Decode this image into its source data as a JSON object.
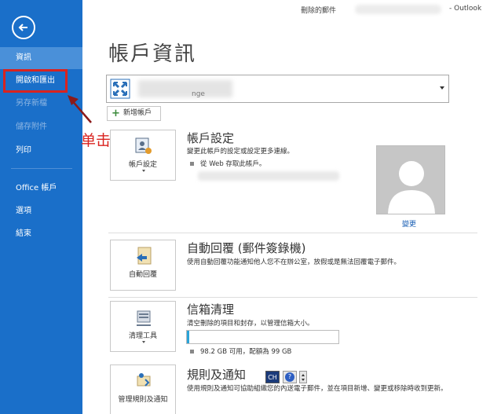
{
  "titlebar": {
    "folder": "刪除的郵件",
    "separator_app": "- Outlook"
  },
  "sidebar": {
    "items": [
      {
        "label": "資訊"
      },
      {
        "label": "開啟和匯出"
      },
      {
        "label": "另存新檔"
      },
      {
        "label": "儲存附件"
      },
      {
        "label": "列印"
      },
      {
        "label": "Office 帳戶"
      },
      {
        "label": "選項"
      },
      {
        "label": "結束"
      }
    ]
  },
  "annotation": {
    "text": "单击"
  },
  "page": {
    "title": "帳戶資訊"
  },
  "account": {
    "sub": "nge",
    "add_label": "新增帳戶"
  },
  "sections": {
    "account_settings": {
      "tile_label": "帳戶設定",
      "title": "帳戶設定",
      "desc": "變更此帳戶的設定或設定更多連線。",
      "bullet": "從 Web 存取此帳戶。",
      "change_link": "變更"
    },
    "auto_reply": {
      "tile_label": "自動回覆",
      "title": "自動回覆 (郵件簽錄機)",
      "desc": "使用自動回覆功能通知他人您不在辦公室，放假或是無法回覆電子郵件。"
    },
    "cleanup": {
      "tile_label": "清理工具",
      "title": "信箱清理",
      "desc": "清空刪除的項目和封存，以管理信箱大小。",
      "usage_text": "98.2 GB 可用，配額為 99 GB",
      "usage_fraction": 0.008
    },
    "rules": {
      "tile_label": "管理規則及通知",
      "title": "規則及通知",
      "desc": "使用規則及通知可協助組織您的內送電子郵件，並在項目新增、變更或移除時收到更新。"
    }
  },
  "language_bar": {
    "lang": "CH",
    "help": "?"
  },
  "colors": {
    "sidebar": "#1a6fc9",
    "sidebar_active": "#4a90d9",
    "highlight_red": "#d9231f",
    "storage_fill": "#2aa3d8"
  }
}
